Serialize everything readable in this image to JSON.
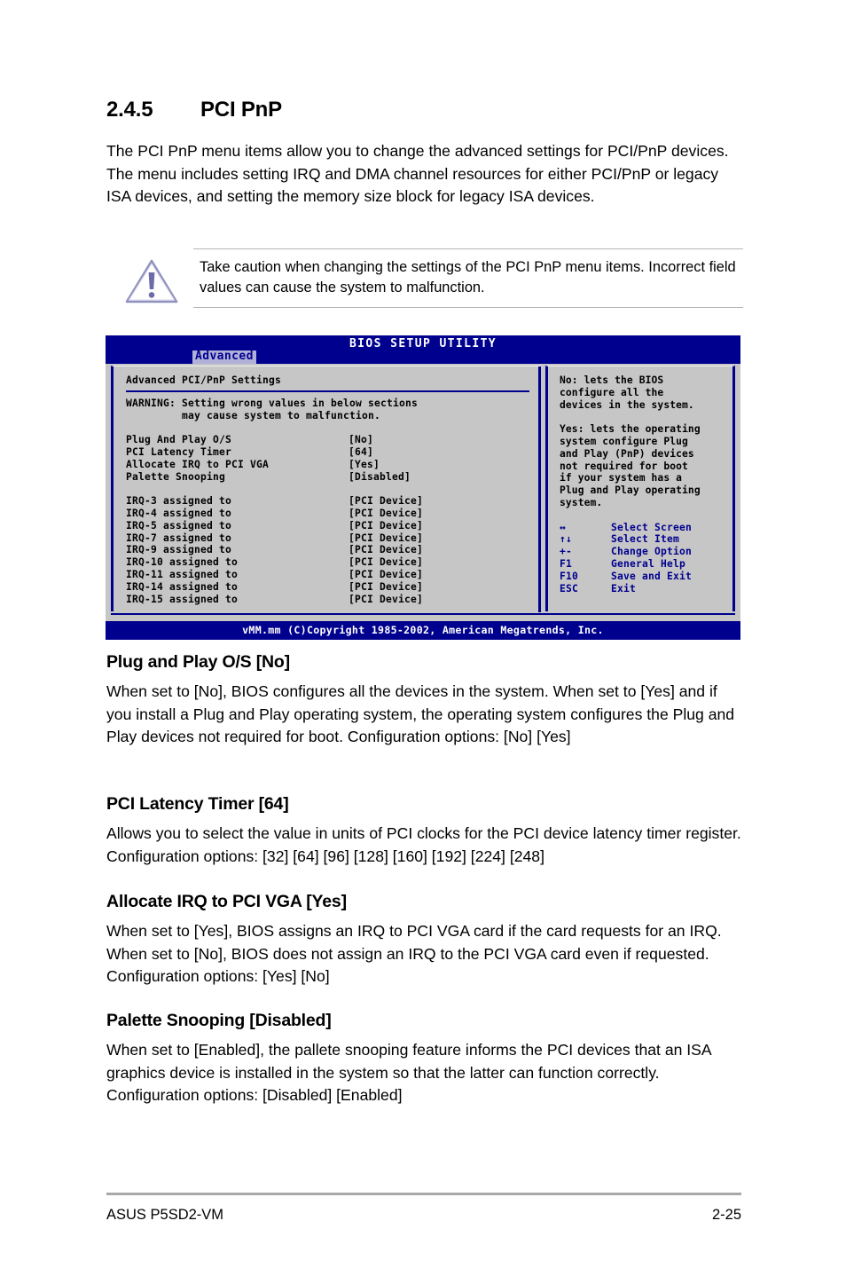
{
  "section": {
    "number": "2.4.5",
    "title": "PCI PnP",
    "intro": "The PCI PnP menu items allow you to change the advanced settings for PCI/PnP devices. The menu includes setting IRQ and DMA channel resources for either PCI/PnP or legacy ISA devices, and setting the memory size block for legacy ISA devices."
  },
  "caution": {
    "icon": "warning-triangle-icon",
    "text": "Take caution when changing the settings of the PCI PnP menu items. Incorrect field values can cause the system to malfunction."
  },
  "bios": {
    "title": "BIOS SETUP UTILITY",
    "active_tab": "Advanced",
    "panel_title": "Advanced PCI/PnP Settings",
    "warning_line1": "WARNING: Setting wrong values in below sections",
    "warning_line2": "         may cause system to malfunction.",
    "settings": [
      {
        "label": "Plug And Play O/S",
        "value": "[No]"
      },
      {
        "label": "PCI Latency Timer",
        "value": "[64]"
      },
      {
        "label": "Allocate IRQ to PCI VGA",
        "value": "[Yes]"
      },
      {
        "label": "Palette Snooping",
        "value": "[Disabled]"
      }
    ],
    "irq_items": [
      {
        "label": "IRQ-3 assigned to",
        "value": "[PCI Device]"
      },
      {
        "label": "IRQ-4 assigned to",
        "value": "[PCI Device]"
      },
      {
        "label": "IRQ-5 assigned to",
        "value": "[PCI Device]"
      },
      {
        "label": "IRQ-7 assigned to",
        "value": "[PCI Device]"
      },
      {
        "label": "IRQ-9 assigned to",
        "value": "[PCI Device]"
      },
      {
        "label": "IRQ-10 assigned to",
        "value": "[PCI Device]"
      },
      {
        "label": "IRQ-11 assigned to",
        "value": "[PCI Device]"
      },
      {
        "label": "IRQ-14 assigned to",
        "value": "[PCI Device]"
      },
      {
        "label": "IRQ-15 assigned to",
        "value": "[PCI Device]"
      }
    ],
    "help_para1": "No: lets the BIOS\nconfigure all the\ndevices in the system.",
    "help_para2": "Yes: lets the operating\nsystem configure Plug\nand Play (PnP) devices\nnot required for boot\nif your system has a\nPlug and Play operating\nsystem.",
    "keys": [
      {
        "key": "↔",
        "label": "Select Screen"
      },
      {
        "key": "↑↓",
        "label": "Select Item"
      },
      {
        "key": "+-",
        "label": "Change Option"
      },
      {
        "key": "F1",
        "label": "General Help"
      },
      {
        "key": "F10",
        "label": "Save and Exit"
      },
      {
        "key": "ESC",
        "label": "Exit"
      }
    ],
    "copyright": "vMM.mm (C)Copyright 1985-2002, American Megatrends, Inc.",
    "colors": {
      "chrome_blue": "#00008f",
      "screen_gray": "#c6c6c6",
      "tab_highlight": "#b0b0d8"
    }
  },
  "sections": [
    {
      "heading": "Plug and Play O/S [No]",
      "body": "When set to [No], BIOS configures all the devices in the system. When set to [Yes] and if you install a Plug and Play operating system, the operating system configures the Plug and Play devices not required for boot.\nConfiguration options: [No] [Yes]"
    },
    {
      "heading": "PCI Latency Timer [64]",
      "body": "Allows you to select the value in units of PCI clocks for the PCI device latency timer register. Configuration options: [32] [64] [96] [128] [160] [192] [224] [248]"
    },
    {
      "heading": "Allocate IRQ to PCI VGA [Yes]",
      "body": "When set to [Yes], BIOS assigns an IRQ to PCI VGA card if the card requests for an IRQ. When set to [No], BIOS does not assign an IRQ to the PCI VGA card even if requested. Configuration options: [Yes] [No]"
    },
    {
      "heading": "Palette Snooping [Disabled]",
      "body": "When set to [Enabled], the pallete snooping feature informs the PCI devices that an ISA graphics device is installed in the system so that the latter can function correctly. Configuration options: [Disabled] [Enabled]"
    }
  ],
  "footer": {
    "left": "ASUS P5SD2-VM",
    "right": "2-25"
  }
}
